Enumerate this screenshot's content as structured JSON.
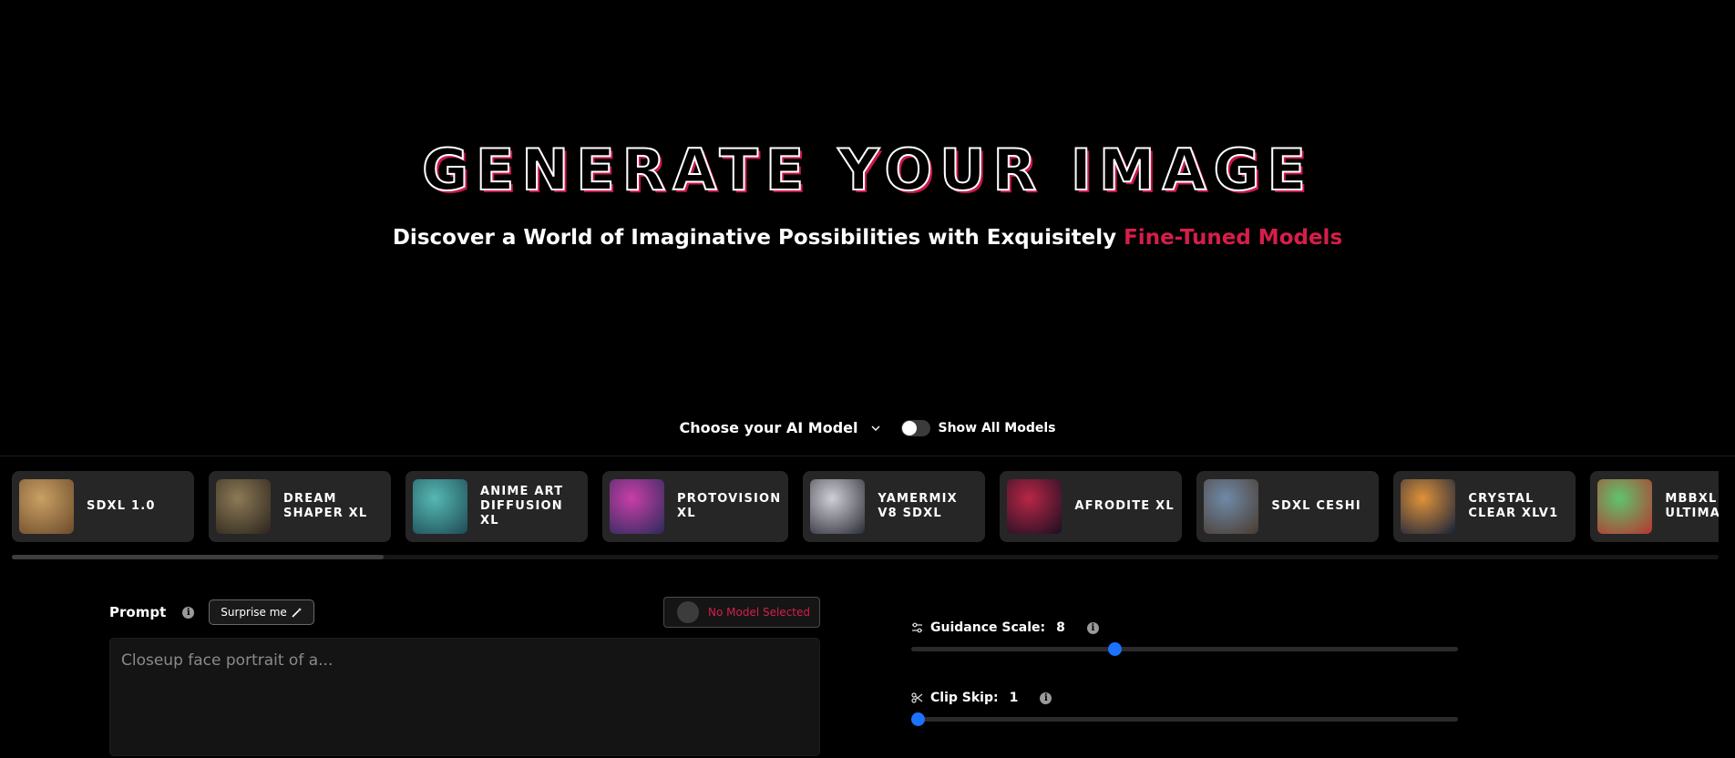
{
  "hero": {
    "title": "GENERATE YOUR IMAGE",
    "subtitle_main": "Discover a World of Imaginative Possibilities with Exquisitely ",
    "subtitle_accent": "Fine-Tuned Models"
  },
  "model_selector": {
    "label": "Choose your AI Model",
    "show_all_label": "Show All Models",
    "show_all_enabled": false
  },
  "models": [
    {
      "name": "SDXL 1.0",
      "colors": [
        "#c9a064",
        "#6b4a2a"
      ]
    },
    {
      "name": "DREAM SHAPER XL",
      "colors": [
        "#8d7a56",
        "#2a241c"
      ]
    },
    {
      "name": "ANIME ART DIFFUSION XL",
      "colors": [
        "#56b8b3",
        "#1d4a53"
      ]
    },
    {
      "name": "PROTOVISION XL",
      "colors": [
        "#c83fa8",
        "#2a2a5a"
      ]
    },
    {
      "name": "YAMERMIX V8 SDXL",
      "colors": [
        "#cfcfd6",
        "#2a2c35"
      ]
    },
    {
      "name": "AFRODITE XL",
      "colors": [
        "#b82646",
        "#1a0f22"
      ]
    },
    {
      "name": "SDXL CESHI",
      "colors": [
        "#6f8aa8",
        "#4a3a2e"
      ]
    },
    {
      "name": "CRYSTAL CLEAR XLV1",
      "colors": [
        "#e0923a",
        "#14213a"
      ]
    },
    {
      "name": "MBBXL ULTIMATE",
      "colors": [
        "#5fc46e",
        "#b8342e"
      ]
    }
  ],
  "prompt": {
    "label": "Prompt",
    "surprise_label": "Surprise me",
    "no_model_label": "No Model Selected",
    "placeholder": "Closeup face portrait of a..."
  },
  "params": {
    "guidance": {
      "label": "Guidance Scale:",
      "value": "8",
      "fraction": 0.372
    },
    "clip_skip": {
      "label": "Clip Skip:",
      "value": "1",
      "fraction": 0.0
    }
  },
  "colors": {
    "accent": "#d61e4a",
    "slider": "#1a72ff"
  },
  "icons": {
    "chevron": "chevron-down-icon",
    "info": "info-icon",
    "wand": "magic-wand-icon",
    "sliders": "sliders-icon",
    "scissors": "scissors-icon"
  }
}
